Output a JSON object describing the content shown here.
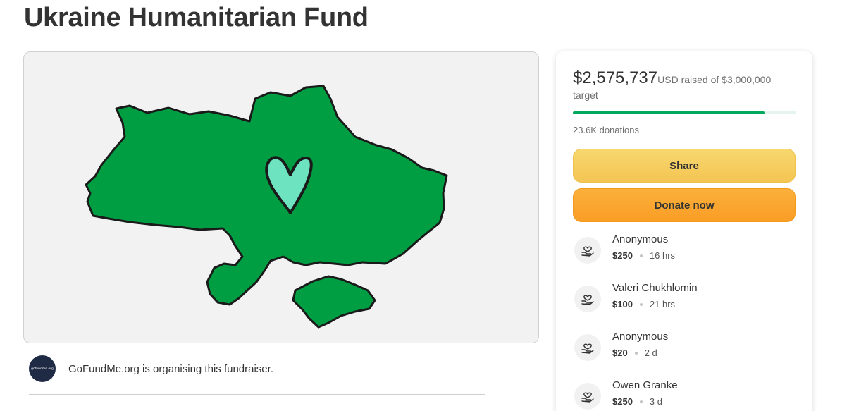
{
  "page": {
    "title": "Ukraine Humanitarian Fund"
  },
  "hero": {
    "image": "ukraine-map-with-heart",
    "map_color": "#009e43",
    "heart_color": "#6ee3bf"
  },
  "organiser": {
    "avatar_text": "gofundme.org",
    "text": "GoFundMe.org is organising this fundraiser."
  },
  "donation_card": {
    "raised_amount": "$2,575,737",
    "raised_rest": "USD raised of $3,000,000 target",
    "progress_fraction": 0.8586,
    "donations_count": "23.6K donations",
    "share_label": "Share",
    "donate_label": "Donate now",
    "donors": [
      {
        "name": "Anonymous",
        "amount": "$250",
        "time": "16 hrs"
      },
      {
        "name": "Valeri Chukhlomin",
        "amount": "$100",
        "time": "21 hrs"
      },
      {
        "name": "Anonymous",
        "amount": "$20",
        "time": "2 d"
      },
      {
        "name": "Owen Granke",
        "amount": "$250",
        "time": "3 d"
      }
    ]
  },
  "colors": {
    "accent_green": "#02a95c",
    "share_yellow": "#f5ca58",
    "donate_orange": "#faa530"
  }
}
